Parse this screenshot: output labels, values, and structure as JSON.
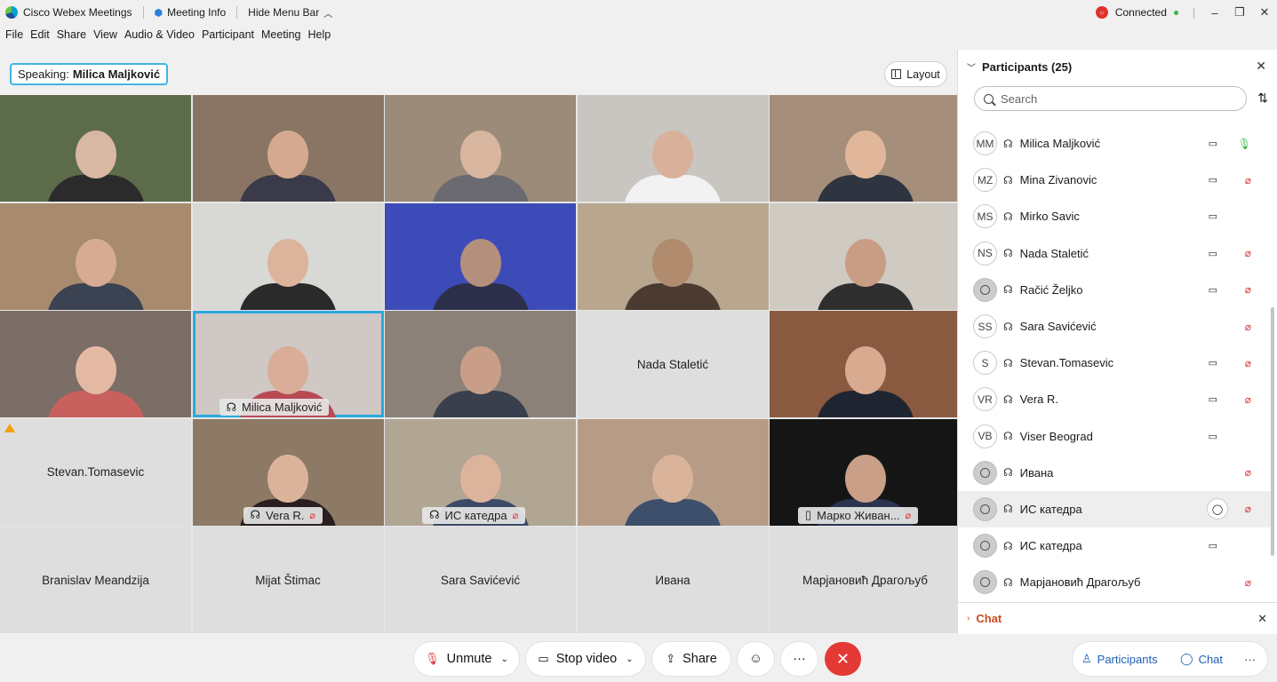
{
  "titlebar": {
    "app_name": "Cisco Webex Meetings",
    "meeting_info": "Meeting Info",
    "hide_menu": "Hide Menu Bar",
    "status": "Connected"
  },
  "menu": [
    "File",
    "Edit",
    "Share",
    "View",
    "Audio & Video",
    "Participant",
    "Meeting",
    "Help"
  ],
  "speaking": {
    "label": "Speaking:",
    "name": "Milica Maljković"
  },
  "layout_label": "Layout",
  "tiles": [
    {
      "name": "",
      "video": true,
      "bg": "#5c6b4a",
      "skin": "#d9b8a3",
      "shirt": "#2b2b2b"
    },
    {
      "name": "",
      "video": true,
      "bg": "#8a7564",
      "skin": "#d5a98f",
      "shirt": "#3a3a4a"
    },
    {
      "name": "",
      "video": true,
      "bg": "#9c8b79",
      "skin": "#d8b6a0",
      "shirt": "#6a6a70"
    },
    {
      "name": "",
      "video": true,
      "bg": "#c9c6c1",
      "skin": "#d9b09a",
      "shirt": "#f2f2f2"
    },
    {
      "name": "",
      "video": true,
      "bg": "#a58e7a",
      "skin": "#e0b79a",
      "shirt": "#2e3440"
    },
    {
      "name": "",
      "video": true,
      "bg": "#a88b6e",
      "skin": "#d6ab92",
      "shirt": "#3b4252"
    },
    {
      "name": "",
      "video": true,
      "bg": "#d8d8d4",
      "skin": "#dcb39b",
      "shirt": "#2a2a2a"
    },
    {
      "name": "",
      "video": true,
      "bg": "#3d4bb8",
      "skin": "#b48f7c",
      "shirt": "#2b2f4a"
    },
    {
      "name": "",
      "video": true,
      "bg": "#b9a68e",
      "skin": "#b08b6e",
      "shirt": "#4a3a30"
    },
    {
      "name": "",
      "video": true,
      "bg": "#cfcac2",
      "skin": "#c99c84",
      "shirt": "#2e2e2e"
    },
    {
      "name": "",
      "video": true,
      "bg": "#7a6e66",
      "skin": "#e3b9a4",
      "shirt": "#c8605e"
    },
    {
      "name": "Milica Maljković",
      "video": true,
      "active": true,
      "headset": true,
      "bg": "#cfc8c4",
      "skin": "#d9ad97",
      "shirt": "#b84a55"
    },
    {
      "name": "",
      "video": true,
      "bg": "#8b8178",
      "skin": "#c99e88",
      "shirt": "#3a3f4d"
    },
    {
      "name": "Nada Staletić",
      "video": false
    },
    {
      "name": "",
      "video": true,
      "bg": "#8a5a40",
      "skin": "#d8ab91",
      "shirt": "#1f2530"
    },
    {
      "name": "Stevan.Tomasevic",
      "video": false,
      "warn": true
    },
    {
      "name": "Vera R.",
      "video": true,
      "headset": true,
      "muted": true,
      "bg": "#8c7a66",
      "skin": "#dbb39b",
      "shirt": "#2a1e1e"
    },
    {
      "name": "ИС катедра",
      "video": true,
      "headset": true,
      "muted": true,
      "bg": "#b1a594",
      "skin": "#dcb39b",
      "shirt": "#3b4a66"
    },
    {
      "name": "",
      "video": true,
      "bg": "#b69c86",
      "skin": "#d9b39a",
      "shirt": "#3d4f6b"
    },
    {
      "name": "Марко Живан...",
      "video": true,
      "phone": true,
      "muted": true,
      "bg": "#151515",
      "skin": "#c99f88",
      "shirt": "#2a3350"
    },
    {
      "name": "Branislav Meandzija",
      "video": false
    },
    {
      "name": "Mijat Štimac",
      "video": false
    },
    {
      "name": "Sara Savićević",
      "video": false
    },
    {
      "name": "Ивана",
      "video": false
    },
    {
      "name": "Марјановић Драгољуб",
      "video": false
    }
  ],
  "panel": {
    "title": "Participants (25)",
    "search_placeholder": "Search",
    "participants": [
      {
        "initials": "MM",
        "name": "Milica Maljković",
        "cam": true,
        "mic": "on"
      },
      {
        "initials": "MZ",
        "name": "Mina Zivanovic",
        "cam": true,
        "mic": "muted"
      },
      {
        "initials": "MS",
        "name": "Mirko Savic",
        "cam": true,
        "mic": ""
      },
      {
        "initials": "NS",
        "name": "Nada Staletić",
        "cam": true,
        "mic": "muted"
      },
      {
        "initials": "",
        "name": "Račić Željko",
        "cam": true,
        "mic": "muted",
        "photo": true
      },
      {
        "initials": "SS",
        "name": "Sara Savićević",
        "cam": false,
        "mic": "muted"
      },
      {
        "initials": "S",
        "name": "Stevan.Tomasevic",
        "cam": true,
        "mic": "muted"
      },
      {
        "initials": "VR",
        "name": "Vera R.",
        "cam": true,
        "mic": "muted"
      },
      {
        "initials": "VB",
        "name": "Viser Beograd",
        "cam": true,
        "mic": ""
      },
      {
        "initials": "",
        "name": "Ивана",
        "cam": false,
        "mic": "muted",
        "photo": true
      },
      {
        "initials": "",
        "name": "ИС катедра",
        "cam": false,
        "mic": "muted",
        "photo": true,
        "chat": true,
        "highlight": true
      },
      {
        "initials": "",
        "name": "ИС катедра",
        "cam": true,
        "mic": "",
        "photo": true
      },
      {
        "initials": "",
        "name": "Марјановић Драгољуб",
        "cam": false,
        "mic": "muted",
        "photo": true
      }
    ],
    "chat_label": "Chat"
  },
  "controls": {
    "unmute": "Unmute",
    "stop_video": "Stop video",
    "share": "Share",
    "participants": "Participants",
    "chat": "Chat"
  }
}
